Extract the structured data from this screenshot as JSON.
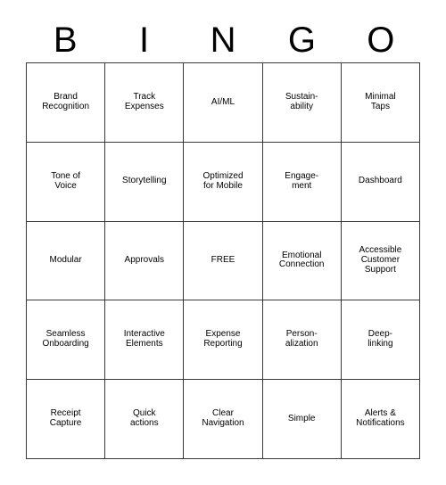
{
  "card": {
    "title": "BINGO",
    "header_letters": [
      "B",
      "I",
      "N",
      "G",
      "O"
    ],
    "grid_size": "5x5",
    "free_space": "FREE",
    "border_color": "#3a3a3a",
    "text_color": "#000000",
    "background_color": "#ffffff",
    "cells": [
      {
        "text": "Brand\nRecognition"
      },
      {
        "text": "Track\nExpenses"
      },
      {
        "text": "AI/ML"
      },
      {
        "text": "Sustain-\nability"
      },
      {
        "text": "Minimal\nTaps"
      },
      {
        "text": "Tone of\nVoice"
      },
      {
        "text": "Storytelling"
      },
      {
        "text": "Optimized\nfor Mobile"
      },
      {
        "text": "Engage-\nment"
      },
      {
        "text": "Dashboard"
      },
      {
        "text": "Modular"
      },
      {
        "text": "Approvals"
      },
      {
        "text": "FREE"
      },
      {
        "text": "Emotional\nConnection"
      },
      {
        "text": "Accessible\nCustomer\nSupport"
      },
      {
        "text": "Seamless\nOnboarding"
      },
      {
        "text": "Interactive\nElements"
      },
      {
        "text": "Expense\nReporting"
      },
      {
        "text": "Person-\nalization"
      },
      {
        "text": "Deep-\nlinking"
      },
      {
        "text": "Receipt\nCapture"
      },
      {
        "text": "Quick\nactions"
      },
      {
        "text": "Clear\nNavigation"
      },
      {
        "text": "Simple"
      },
      {
        "text": "Alerts &\nNotifications"
      }
    ]
  }
}
